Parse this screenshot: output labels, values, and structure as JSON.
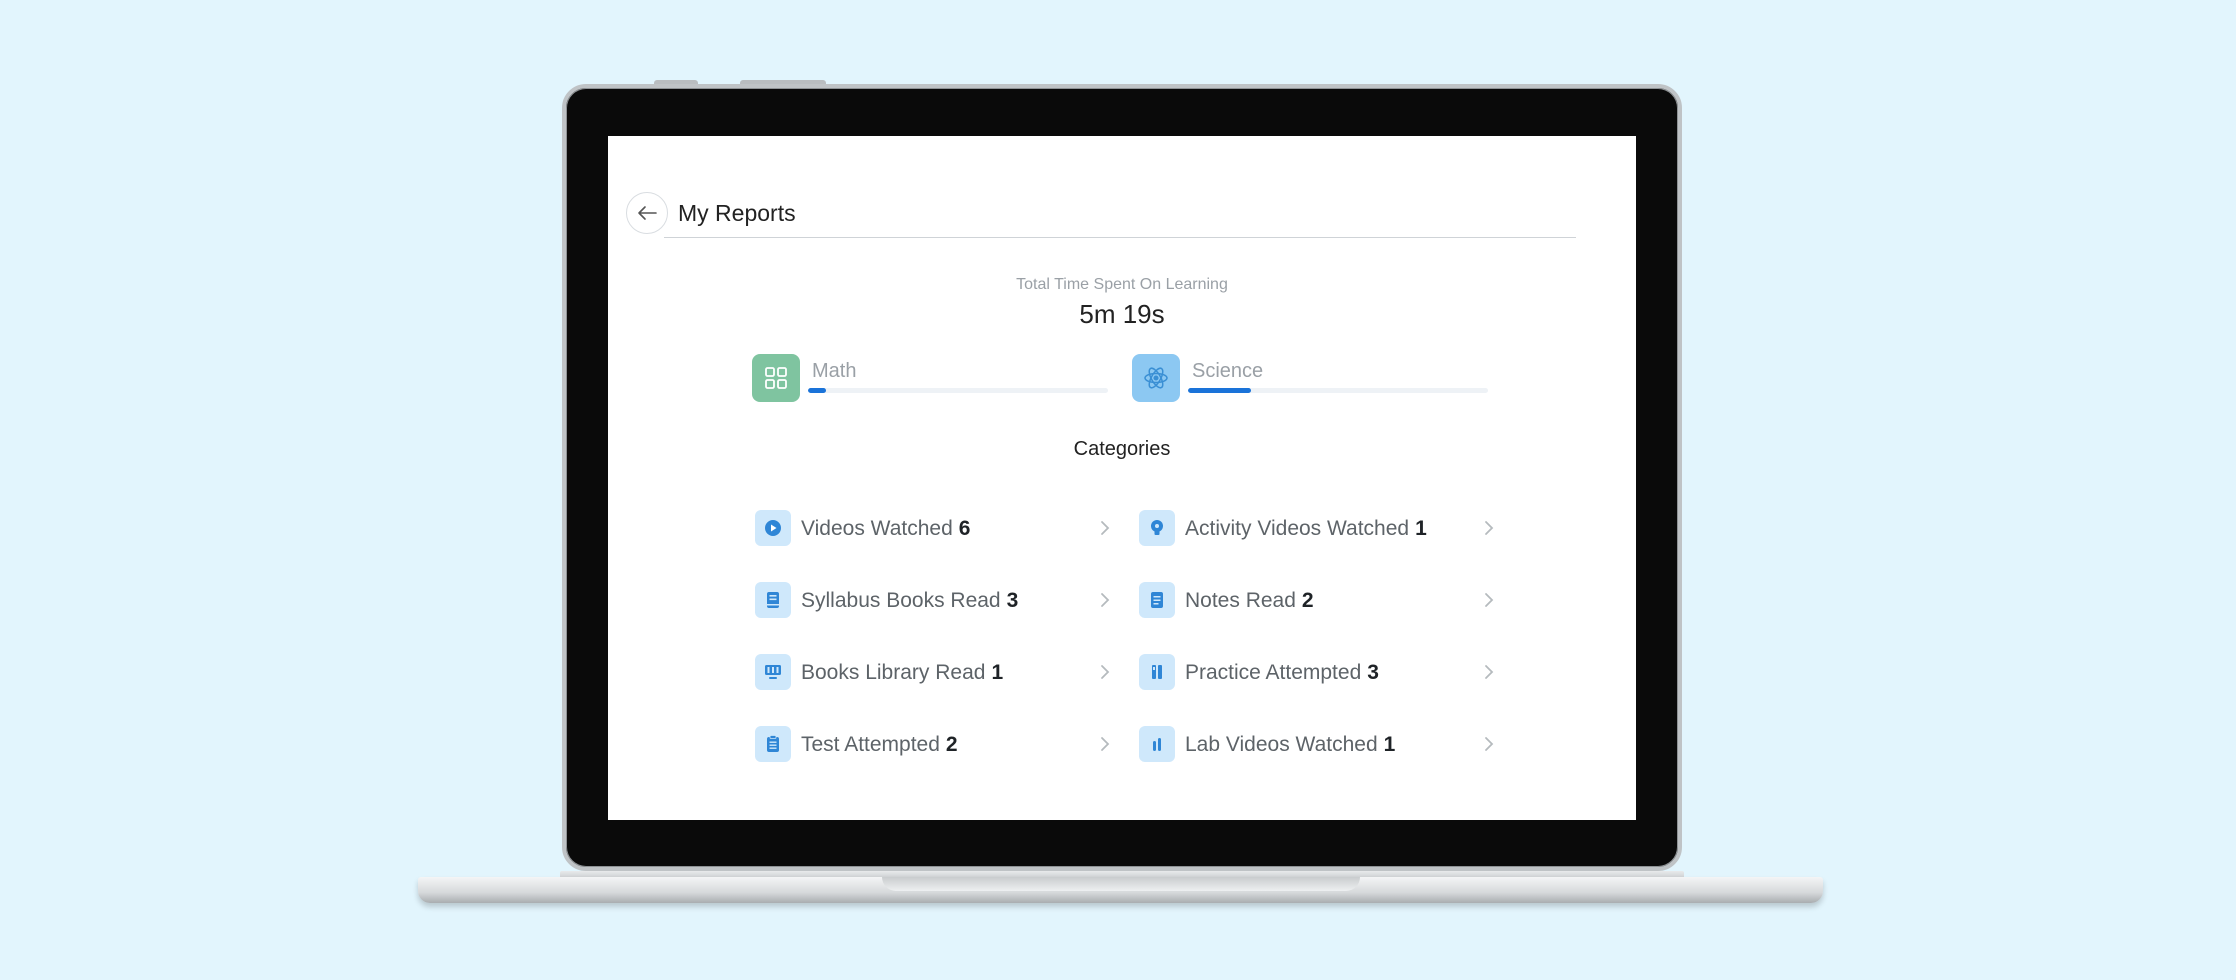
{
  "header": {
    "title": "My Reports"
  },
  "summary": {
    "label": "Total Time Spent On Learning",
    "value": "5m 19s"
  },
  "subjects": [
    {
      "name": "Math",
      "progress_pct": 6,
      "icon": "grid-icon",
      "color": "#7fc4a0"
    },
    {
      "name": "Science",
      "progress_pct": 21,
      "icon": "atom-icon",
      "color": "#8cc8f2"
    }
  ],
  "categories": {
    "title": "Categories",
    "items": [
      {
        "label": "Videos Watched",
        "count": "6",
        "icon": "play-icon"
      },
      {
        "label": "Activity Videos Watched",
        "count": "1",
        "icon": "lightbulb-icon"
      },
      {
        "label": "Syllabus Books Read",
        "count": "3",
        "icon": "book-icon"
      },
      {
        "label": "Notes Read",
        "count": "2",
        "icon": "notes-icon"
      },
      {
        "label": "Books Library Read",
        "count": "1",
        "icon": "library-icon"
      },
      {
        "label": "Practice Attempted",
        "count": "3",
        "icon": "practice-icon"
      },
      {
        "label": "Test Attempted",
        "count": "2",
        "icon": "clipboard-icon"
      },
      {
        "label": "Lab Videos Watched",
        "count": "1",
        "icon": "flask-icon"
      }
    ]
  },
  "accent_color": "#1a73d9"
}
